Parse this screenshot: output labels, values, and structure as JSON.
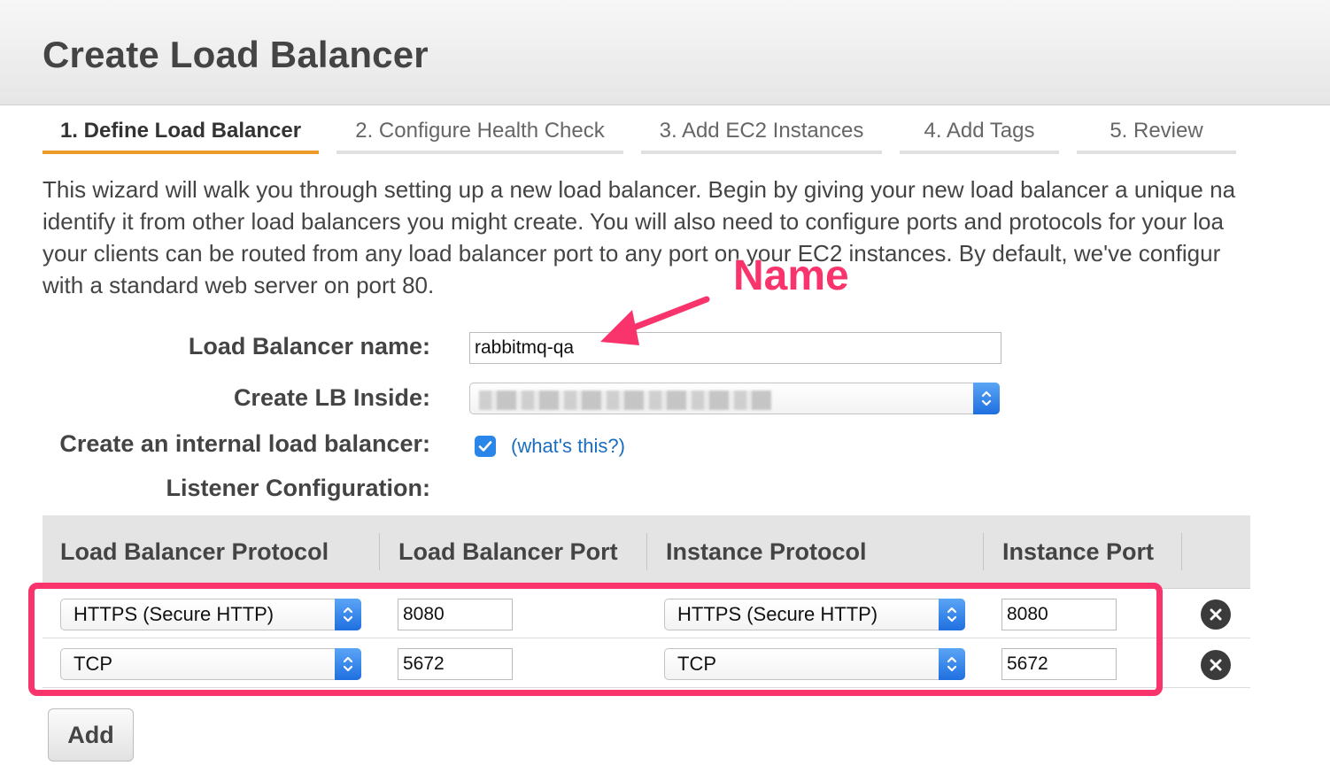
{
  "header": {
    "title": "Create Load Balancer"
  },
  "tabs": [
    {
      "label": "1. Define Load Balancer",
      "active": true
    },
    {
      "label": "2. Configure Health Check",
      "active": false
    },
    {
      "label": "3. Add EC2 Instances",
      "active": false
    },
    {
      "label": "4. Add Tags",
      "active": false
    },
    {
      "label": "5. Review",
      "active": false
    }
  ],
  "intro": {
    "lines": [
      "This wizard will walk you through setting up a new load balancer. Begin by giving your new load balancer a unique na",
      "identify it from other load balancers you might create. You will also need to configure ports and protocols for your loa",
      "your clients can be routed from any load balancer port to any port on your EC2 instances. By default, we've configur",
      "with a standard web server on port 80."
    ]
  },
  "form": {
    "name_label": "Load Balancer name:",
    "name_value": "rabbitmq-qa",
    "inside_label": "Create LB Inside:",
    "inside_value_redacted": true,
    "internal_label": "Create an internal load balancer:",
    "internal_checked": true,
    "whats_this_link": "(what's this?)",
    "listener_label": "Listener Configuration:"
  },
  "listeners": {
    "columns": [
      "Load Balancer Protocol",
      "Load Balancer Port",
      "Instance Protocol",
      "Instance Port"
    ],
    "rows": [
      {
        "lb_protocol": "HTTPS (Secure HTTP)",
        "lb_port": "8080",
        "instance_protocol": "HTTPS (Secure HTTP)",
        "instance_port": "8080"
      },
      {
        "lb_protocol": "TCP",
        "lb_port": "5672",
        "instance_protocol": "TCP",
        "instance_port": "5672"
      }
    ],
    "add_label": "Add"
  },
  "annotation": {
    "text": "Name",
    "color": "#f9336b"
  },
  "colors": {
    "active_tab": "#ec9b2a",
    "link": "#1a6dbf",
    "checkbox": "#2a86e8",
    "select_arrow": "#2a7be6"
  }
}
